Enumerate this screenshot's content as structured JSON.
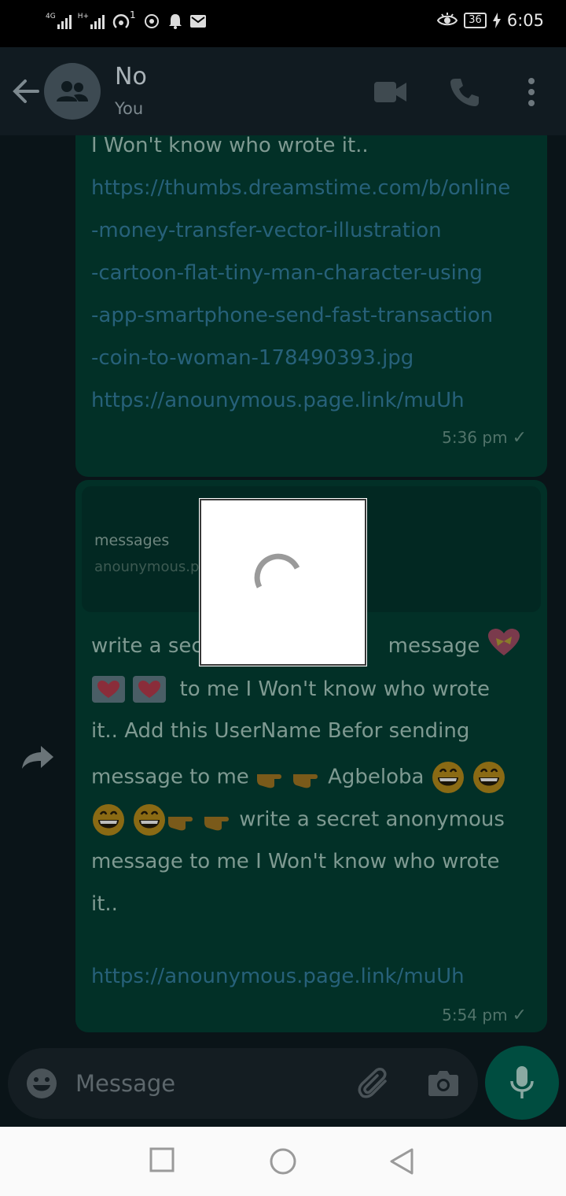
{
  "status_bar": {
    "network_top": "4G",
    "network_second": "H+",
    "notif_count": "1",
    "battery": "36",
    "time": "6:05"
  },
  "header": {
    "title": "No",
    "subtitle": "You"
  },
  "messages": [
    {
      "lines": [
        "I Won't know who wrote it..",
        "https://thumbs.dreamstime.com/b/online",
        "-money-transfer-vector-illustration",
        "-cartoon-flat-tiny-man-character-using",
        "-app-smartphone-send-fast-transaction",
        "-coin-to-woman-178490393.jpg",
        "https://anounymous.page.link/muUh"
      ],
      "time": "5:36 pm"
    },
    {
      "preview_title": "messages",
      "preview_domain": "anounymous.p",
      "line1_a": "write a sec",
      "line1_b": "message",
      "line2_b": "to  me I Won't know who wrote",
      "line3": "it..  Add this UserName Befor sending",
      "line4_a": "message to me",
      "line4_b": "Agbeloba",
      "line5_b": "write a secret anonymous",
      "line6": "message to  me I Won't know who wrote",
      "line7": "it..",
      "link": "https://anounymous.page.link/muUh",
      "time": "5:54 pm"
    }
  ],
  "input": {
    "placeholder": "Message"
  },
  "colors": {
    "bubble": "#023027",
    "link": "#27617a",
    "accent": "#004d40"
  }
}
